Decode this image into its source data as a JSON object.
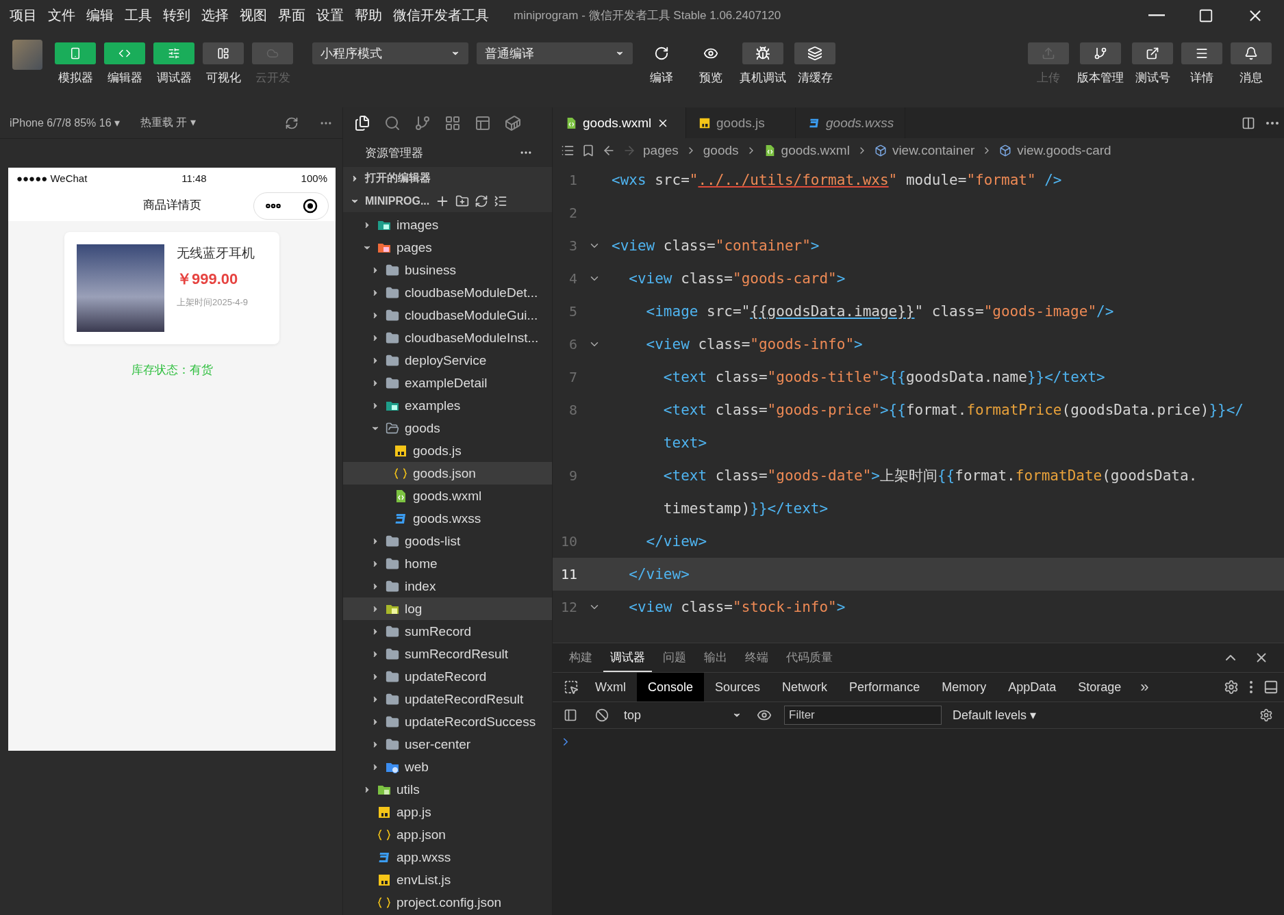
{
  "menu": [
    "项目",
    "文件",
    "编辑",
    "工具",
    "转到",
    "选择",
    "视图",
    "界面",
    "设置",
    "帮助",
    "微信开发者工具"
  ],
  "window": {
    "title": "miniprogram",
    "subtitle": " - 微信开发者工具 Stable 1.06.2407120"
  },
  "toolbar": {
    "modes": [
      {
        "label": "模拟器",
        "on": true,
        "disabled": false
      },
      {
        "label": "编辑器",
        "on": true,
        "disabled": false
      },
      {
        "label": "调试器",
        "on": true,
        "disabled": false
      },
      {
        "label": "可视化",
        "on": false,
        "disabled": false
      },
      {
        "label": "云开发",
        "on": false,
        "disabled": true
      }
    ],
    "mode_select": "小程序模式",
    "compile_select": "普通编译",
    "actions": [
      {
        "label": "编译",
        "framed": false
      },
      {
        "label": "预览",
        "framed": false
      },
      {
        "label": "真机调试",
        "framed": true
      },
      {
        "label": "清缓存",
        "framed": true
      }
    ],
    "right": [
      {
        "label": "上传",
        "disabled": true
      },
      {
        "label": "版本管理",
        "disabled": false
      },
      {
        "label": "测试号",
        "disabled": false
      },
      {
        "label": "详情",
        "disabled": false
      },
      {
        "label": "消息",
        "disabled": false
      }
    ]
  },
  "simulator": {
    "device": "iPhone 6/7/8 85% 16 ▾",
    "hot_reload": "热重载 开 ▾",
    "status": {
      "carrier": "●●●●● WeChat",
      "time": "11:48",
      "battery": "100%"
    },
    "nav_title": "商品详情页",
    "card": {
      "title": "无线蓝牙耳机",
      "price": "￥999.00",
      "date": "上架时间2025-4-9"
    },
    "stock": "库存状态：有货"
  },
  "explorer": {
    "title": "资源管理器",
    "open_editors": "打开的编辑器",
    "project": "MINIPROG...",
    "tree": [
      {
        "name": "images",
        "kind": "images",
        "expanded": false,
        "highlighted": false
      },
      {
        "name": "pages",
        "kind": "pages",
        "expanded": true,
        "highlighted": false,
        "children": [
          {
            "name": "business",
            "kind": "folder",
            "expanded": false,
            "highlighted": false
          },
          {
            "name": "cloudbaseModuleDet...",
            "kind": "folder",
            "expanded": false,
            "highlighted": false
          },
          {
            "name": "cloudbaseModuleGui...",
            "kind": "folder",
            "expanded": false,
            "highlighted": false
          },
          {
            "name": "cloudbaseModuleInst...",
            "kind": "folder",
            "expanded": false,
            "highlighted": false
          },
          {
            "name": "deployService",
            "kind": "folder",
            "expanded": false,
            "highlighted": false
          },
          {
            "name": "exampleDetail",
            "kind": "folder",
            "expanded": false,
            "highlighted": false
          },
          {
            "name": "examples",
            "kind": "images",
            "expanded": false,
            "highlighted": false
          },
          {
            "name": "goods",
            "kind": "folder",
            "expanded": true,
            "highlighted": false,
            "children": [
              {
                "name": "goods.js",
                "kind": "js",
                "highlighted": false
              },
              {
                "name": "goods.json",
                "kind": "json",
                "highlighted": true
              },
              {
                "name": "goods.wxml",
                "kind": "wxml",
                "highlighted": false
              },
              {
                "name": "goods.wxss",
                "kind": "wxss",
                "highlighted": false
              }
            ]
          },
          {
            "name": "goods-list",
            "kind": "folder",
            "expanded": false,
            "highlighted": false
          },
          {
            "name": "home",
            "kind": "folder",
            "expanded": false,
            "highlighted": false
          },
          {
            "name": "index",
            "kind": "folder",
            "expanded": false,
            "highlighted": false
          },
          {
            "name": "log",
            "kind": "log",
            "expanded": false,
            "highlighted": true
          },
          {
            "name": "sumRecord",
            "kind": "folder",
            "expanded": false,
            "highlighted": false
          },
          {
            "name": "sumRecordResult",
            "kind": "folder",
            "expanded": false,
            "highlighted": false
          },
          {
            "name": "updateRecord",
            "kind": "folder",
            "expanded": false,
            "highlighted": false
          },
          {
            "name": "updateRecordResult",
            "kind": "folder",
            "expanded": false,
            "highlighted": false
          },
          {
            "name": "updateRecordSuccess",
            "kind": "folder",
            "expanded": false,
            "highlighted": false
          },
          {
            "name": "user-center",
            "kind": "folder",
            "expanded": false,
            "highlighted": false
          },
          {
            "name": "web",
            "kind": "web",
            "expanded": false,
            "highlighted": false
          }
        ]
      },
      {
        "name": "utils",
        "kind": "utils",
        "expanded": false,
        "highlighted": false
      },
      {
        "name": "app.js",
        "kind": "js",
        "highlighted": false
      },
      {
        "name": "app.json",
        "kind": "json",
        "highlighted": false
      },
      {
        "name": "app.wxss",
        "kind": "wxss",
        "highlighted": false
      },
      {
        "name": "envList.js",
        "kind": "js",
        "highlighted": false
      },
      {
        "name": "project.config.json",
        "kind": "json",
        "highlighted": false
      }
    ]
  },
  "editor": {
    "tabs": [
      {
        "label": "goods.wxml",
        "kind": "wxml",
        "selected": true,
        "preview": false
      },
      {
        "label": "goods.js",
        "kind": "js",
        "selected": false,
        "preview": false
      },
      {
        "label": "goods.wxss",
        "kind": "wxss",
        "selected": false,
        "preview": true
      }
    ],
    "breadcrumb": [
      {
        "label": "pages",
        "kind": "folder"
      },
      {
        "label": "goods",
        "kind": "folder"
      },
      {
        "label": "goods.wxml",
        "kind": "wxml"
      },
      {
        "label": "view.container",
        "kind": "element"
      },
      {
        "label": "view.goods-card",
        "kind": "element"
      }
    ],
    "lines": [
      {
        "number": "1",
        "foldable": false,
        "current": false,
        "rows": [
          [
            {
              "kind": "tag",
              "text": "<wxs"
            },
            {
              "kind": "attr",
              "text": " src="
            },
            {
              "kind": "str",
              "text": "\""
            },
            {
              "kind": "link",
              "text": "../../utils/format.wxs"
            },
            {
              "kind": "str",
              "text": "\""
            },
            {
              "kind": "attr",
              "text": " module="
            },
            {
              "kind": "str",
              "text": "\"format\""
            },
            {
              "kind": "tag",
              "text": " />"
            }
          ]
        ]
      },
      {
        "number": "2",
        "foldable": false,
        "current": false,
        "rows": [
          []
        ]
      },
      {
        "number": "3",
        "foldable": true,
        "current": false,
        "rows": [
          [
            {
              "kind": "tag",
              "text": "<view"
            },
            {
              "kind": "attr",
              "text": " class="
            },
            {
              "kind": "str",
              "text": "\"container\""
            },
            {
              "kind": "tag",
              "text": ">"
            }
          ]
        ]
      },
      {
        "number": "4",
        "foldable": true,
        "current": false,
        "rows": [
          [
            {
              "kind": "tag",
              "text": "  <view"
            },
            {
              "kind": "attr",
              "text": " class="
            },
            {
              "kind": "str",
              "text": "\"goods-card\""
            },
            {
              "kind": "tag",
              "text": ">"
            }
          ]
        ]
      },
      {
        "number": "5",
        "foldable": false,
        "current": false,
        "rows": [
          [
            {
              "kind": "tag",
              "text": "    <image"
            },
            {
              "kind": "attr",
              "text": " src=\""
            },
            {
              "kind": "ref",
              "text": "{{goodsData.image}}"
            },
            {
              "kind": "attr",
              "text": "\" class="
            },
            {
              "kind": "str",
              "text": "\"goods-image\""
            },
            {
              "kind": "tag",
              "text": "/>"
            }
          ]
        ]
      },
      {
        "number": "6",
        "foldable": true,
        "current": false,
        "rows": [
          [
            {
              "kind": "tag",
              "text": "    <view"
            },
            {
              "kind": "attr",
              "text": " class="
            },
            {
              "kind": "str",
              "text": "\"goods-info\""
            },
            {
              "kind": "tag",
              "text": ">"
            }
          ]
        ]
      },
      {
        "number": "7",
        "foldable": false,
        "current": false,
        "rows": [
          [
            {
              "kind": "tag",
              "text": "      <text"
            },
            {
              "kind": "attr",
              "text": " class="
            },
            {
              "kind": "str",
              "text": "\"goods-title\""
            },
            {
              "kind": "tag",
              "text": ">{{"
            },
            {
              "kind": "attr",
              "text": "goodsData.name"
            },
            {
              "kind": "tag",
              "text": "}}</text>"
            }
          ]
        ]
      },
      {
        "number": "8",
        "foldable": false,
        "current": false,
        "rows": [
          [
            {
              "kind": "tag",
              "text": "      <text"
            },
            {
              "kind": "attr",
              "text": " class="
            },
            {
              "kind": "str",
              "text": "\"goods-price\""
            },
            {
              "kind": "tag",
              "text": ">{{"
            },
            {
              "kind": "attr",
              "text": "format."
            },
            {
              "kind": "fn",
              "text": "formatPrice"
            },
            {
              "kind": "attr",
              "text": "(goodsData.price)"
            },
            {
              "kind": "tag",
              "text": "}}</"
            }
          ],
          [
            {
              "kind": "tag",
              "text": "      text>"
            }
          ]
        ]
      },
      {
        "number": "9",
        "foldable": false,
        "current": false,
        "rows": [
          [
            {
              "kind": "tag",
              "text": "      <text"
            },
            {
              "kind": "attr",
              "text": " class="
            },
            {
              "kind": "str",
              "text": "\"goods-date\""
            },
            {
              "kind": "tag",
              "text": ">"
            },
            {
              "kind": "attr",
              "text": "上架时间"
            },
            {
              "kind": "tag",
              "text": "{{"
            },
            {
              "kind": "attr",
              "text": "format."
            },
            {
              "kind": "fn",
              "text": "formatDate"
            },
            {
              "kind": "attr",
              "text": "(goodsData."
            }
          ],
          [
            {
              "kind": "attr",
              "text": "      timestamp)"
            },
            {
              "kind": "tag",
              "text": "}}</text>"
            }
          ]
        ]
      },
      {
        "number": "10",
        "foldable": false,
        "current": false,
        "rows": [
          [
            {
              "kind": "tag",
              "text": "    </view>"
            }
          ]
        ]
      },
      {
        "number": "11",
        "foldable": false,
        "current": true,
        "rows": [
          [
            {
              "kind": "tag",
              "text": "  </view>"
            }
          ]
        ]
      },
      {
        "number": "12",
        "foldable": true,
        "current": false,
        "rows": [
          [
            {
              "kind": "tag",
              "text": "  <view"
            },
            {
              "kind": "attr",
              "text": " class="
            },
            {
              "kind": "str",
              "text": "\"stock-info\""
            },
            {
              "kind": "tag",
              "text": ">"
            }
          ]
        ]
      }
    ]
  },
  "panel": {
    "tabs": [
      {
        "label": "构建",
        "selected": false
      },
      {
        "label": "调试器",
        "selected": true
      },
      {
        "label": "问题",
        "selected": false
      },
      {
        "label": "输出",
        "selected": false
      },
      {
        "label": "终端",
        "selected": false
      },
      {
        "label": "代码质量",
        "selected": false
      }
    ],
    "devtools_tabs": [
      {
        "label": "Wxml",
        "selected": false
      },
      {
        "label": "Console",
        "selected": true
      },
      {
        "label": "Sources",
        "selected": false
      },
      {
        "label": "Network",
        "selected": false
      },
      {
        "label": "Performance",
        "selected": false
      },
      {
        "label": "Memory",
        "selected": false
      },
      {
        "label": "AppData",
        "selected": false
      },
      {
        "label": "Storage",
        "selected": false
      }
    ],
    "more": "»",
    "context": "top",
    "filter": {
      "placeholder": "Filter"
    },
    "levels": "Default levels ▾"
  }
}
